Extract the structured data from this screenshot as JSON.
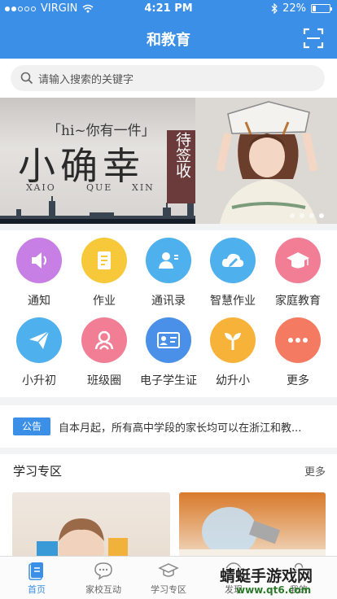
{
  "status_bar": {
    "carrier": "VIRGIN",
    "time": "4:21 PM",
    "battery": "22%",
    "battery_level": 0.22,
    "icons": [
      "signal-dots-icon",
      "wifi-icon",
      "bluetooth-icon",
      "battery-icon"
    ]
  },
  "header": {
    "title": "和教育",
    "scan_icon": "scan-icon"
  },
  "search": {
    "placeholder": "请输入搜索的关键字",
    "icon": "search-icon"
  },
  "banner": {
    "hi_text": "「hi~你有一件」",
    "headline": "小确幸",
    "pinyin": [
      "XAIO",
      "QUE",
      "XIN"
    ],
    "stamp": "待签收",
    "page_count": 4,
    "active_page": 4
  },
  "grid": [
    {
      "label": "通知",
      "icon": "speaker-icon",
      "color": "#c77fe6"
    },
    {
      "label": "作业",
      "icon": "homework-icon",
      "color": "#f7c93a"
    },
    {
      "label": "通讯录",
      "icon": "contacts-icon",
      "color": "#4fb0ee"
    },
    {
      "label": "智慧作业",
      "icon": "cloud-pen-icon",
      "color": "#4fb0ee"
    },
    {
      "label": "家庭教育",
      "icon": "graduation-cap-icon",
      "color": "#f17e94"
    },
    {
      "label": "小升初",
      "icon": "paper-plane-icon",
      "color": "#4fb0ee"
    },
    {
      "label": "班级圈",
      "icon": "class-circle-icon",
      "color": "#f17e94"
    },
    {
      "label": "电子学生证",
      "icon": "id-card-icon",
      "color": "#4a90e8"
    },
    {
      "label": "幼升小",
      "icon": "sprout-icon",
      "color": "#f7b23a"
    },
    {
      "label": "更多",
      "icon": "more-icon",
      "color": "#f47b62"
    }
  ],
  "notice": {
    "tag": "公告",
    "text": "自本月起，所有高中学段的家长均可以在浙江和教..."
  },
  "study": {
    "title": "学习专区",
    "more": "更多"
  },
  "tabbar": [
    {
      "label": "首页",
      "icon": "home-doc-icon",
      "active": true
    },
    {
      "label": "家校互动",
      "icon": "chat-bubble-icon",
      "active": false
    },
    {
      "label": "学习专区",
      "icon": "mortarboard-icon",
      "active": false
    },
    {
      "label": "发现",
      "icon": "compass-icon",
      "active": false
    },
    {
      "label": "我的",
      "icon": "user-icon",
      "active": false
    }
  ],
  "watermark": {
    "line1": "蜻蜓手游戏网",
    "line2": "www.qt6.com"
  },
  "colors": {
    "brand": "#3b8fe6"
  }
}
